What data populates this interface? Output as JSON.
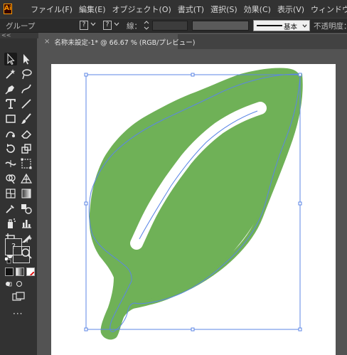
{
  "app": {
    "logo_text": "Ai"
  },
  "menu": [
    "ファイル(F)",
    "編集(E)",
    "オブジェクト(O)",
    "書式(T)",
    "選択(S)",
    "効果(C)",
    "表示(V)",
    "ウィンドウ(W)"
  ],
  "control_bar": {
    "selection_label": "グループ",
    "fill_value": "?",
    "stroke_value": "?",
    "stroke_label": "線：",
    "stroke_style": "基本",
    "opacity_label": "不透明度："
  },
  "panel_collapse": "<<",
  "document_tab": {
    "close": "×",
    "title": "名称未設定-1* @ 66.67 % (RGB/プレビュー)"
  },
  "tools": {
    "fill_stroke_value": "?",
    "more": "···"
  },
  "colors": {
    "leaf": "#6fb157",
    "selection": "#5b86e6",
    "app_logo": "#ff9a00"
  },
  "icons": [
    "home-icon",
    "selection-tool-icon",
    "direct-selection-icon",
    "magic-wand-icon",
    "lasso-icon",
    "pen-icon",
    "curvature-icon",
    "type-icon",
    "line-icon",
    "rectangle-icon",
    "paintbrush-icon",
    "shaper-icon",
    "eraser-icon",
    "rotate-icon",
    "scale-icon",
    "width-icon",
    "free-transform-icon",
    "shape-builder-icon",
    "perspective-icon",
    "mesh-icon",
    "gradient-icon",
    "eyedropper-icon",
    "blend-icon",
    "symbol-sprayer-icon",
    "graph-icon",
    "artboard-icon",
    "slice-icon",
    "hand-icon",
    "zoom-icon"
  ]
}
